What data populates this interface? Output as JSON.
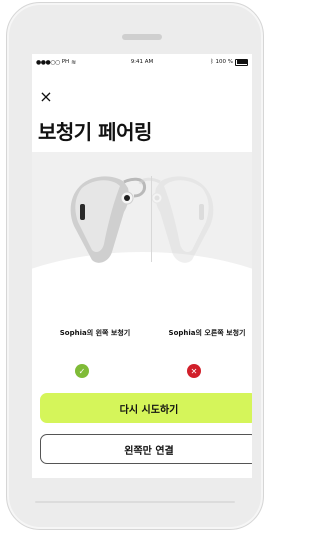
{
  "status_bar": {
    "carrier": "PH",
    "time": "9:41 AM",
    "battery": "100 %"
  },
  "header": {
    "close_icon": "×",
    "title": "보청기 페어링"
  },
  "devices": {
    "left_label": "Sophia의 왼쪽 보청기",
    "left_status": "ok",
    "left_status_icon": "check-icon",
    "right_label": "Sophia의 오른쪽 보청기",
    "right_status": "failed",
    "right_status_icon": "cross-icon"
  },
  "actions": {
    "retry_label": "다시 시도하기",
    "connect_left_only_label": "왼쪽만 연결"
  },
  "colors": {
    "accent": "#d5f55a",
    "success": "#7fbb37",
    "error": "#d11f2a"
  }
}
